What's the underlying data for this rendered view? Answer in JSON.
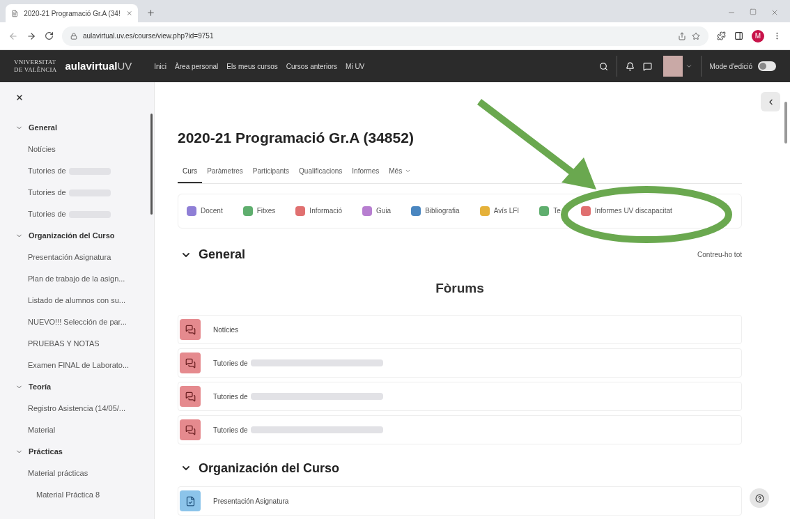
{
  "browser": {
    "tab_title": "2020-21 Programació Gr.A (34!",
    "url": "aulavirtual.uv.es/course/view.php?id=9751",
    "profile_initial": "M"
  },
  "navbar": {
    "logo_lines": [
      "VNIVERSITAT",
      "DE VALÈNCIA"
    ],
    "brand": "aulavirtual",
    "brand_suffix": "UV",
    "links": [
      "Inici",
      "Àrea personal",
      "Els meus cursos",
      "Cursos anteriors",
      "Mi UV"
    ],
    "edit_mode": {
      "label": "Mode d'edició",
      "on": false
    }
  },
  "sidebar": {
    "sections": [
      {
        "title": "General",
        "expanded": true,
        "children": [
          {
            "label": "Notícies",
            "redacted": false
          },
          {
            "label": "Tutories de",
            "redacted": true
          },
          {
            "label": "Tutories de",
            "redacted": true
          },
          {
            "label": "Tutories de",
            "redacted": true
          }
        ]
      },
      {
        "title": "Organización del Curso",
        "expanded": true,
        "children": [
          {
            "label": "Presentación Asignatura",
            "redacted": false
          },
          {
            "label": "Plan de trabajo de la asign...",
            "redacted": false
          },
          {
            "label": "Listado de alumnos con su...",
            "redacted": false
          },
          {
            "label": "NUEVO!!! Selección de par...",
            "redacted": false
          },
          {
            "label": "PRUEBAS Y NOTAS",
            "redacted": false
          },
          {
            "label": "Examen FINAL de Laborato...",
            "redacted": false
          }
        ]
      },
      {
        "title": "Teoría",
        "expanded": true,
        "children": [
          {
            "label": "Registro Asistencia (14/05/...",
            "redacted": false
          },
          {
            "label": "Material",
            "redacted": false
          }
        ]
      },
      {
        "title": "Prácticas",
        "expanded": true,
        "children": [
          {
            "label": "Material prácticas",
            "redacted": false,
            "children": [
              {
                "label": "Material Práctica 8",
                "redacted": false
              }
            ]
          }
        ]
      }
    ]
  },
  "page": {
    "title": "2020-21 Programació Gr.A (34852)",
    "tabs": [
      {
        "label": "Curs",
        "selected": true,
        "kind": "link"
      },
      {
        "label": "Paràmetres",
        "selected": false,
        "kind": "link"
      },
      {
        "label": "Participants",
        "selected": false,
        "kind": "link"
      },
      {
        "label": "Qualificacions",
        "selected": false,
        "kind": "link"
      },
      {
        "label": "Informes",
        "selected": false,
        "kind": "link"
      },
      {
        "label": "Més",
        "selected": false,
        "kind": "dropdown"
      }
    ],
    "toolbar": [
      {
        "label": "Docent",
        "color": "#8f7fd6"
      },
      {
        "label": "Fitxes",
        "color": "#5fae6e"
      },
      {
        "label": "Informació",
        "color": "#e07070"
      },
      {
        "label": "Guia",
        "color": "#b77ed0"
      },
      {
        "label": "Bibliografia",
        "color": "#4a86c0"
      },
      {
        "label": "Avís LFI",
        "color": "#e5b13a"
      },
      {
        "label": "Te",
        "color": "#5fae6e"
      },
      {
        "label": "Informes UV discapacitat",
        "color": "#e07070"
      }
    ],
    "sections": [
      {
        "title": "General",
        "expanded": true,
        "collapse_label": "Contreu-ho tot",
        "subheading": "Fòrums",
        "activities": [
          {
            "label": "Notícies",
            "redacted": false,
            "kind": "forum"
          },
          {
            "label": "Tutories de",
            "redacted": true,
            "kind": "forum"
          },
          {
            "label": "Tutories de",
            "redacted": true,
            "kind": "forum"
          },
          {
            "label": "Tutories de",
            "redacted": true,
            "kind": "forum"
          }
        ]
      },
      {
        "title": "Organización del Curso",
        "expanded": true,
        "activities": [
          {
            "label": "Presentación Asignatura",
            "redacted": false,
            "kind": "page"
          }
        ]
      }
    ]
  }
}
